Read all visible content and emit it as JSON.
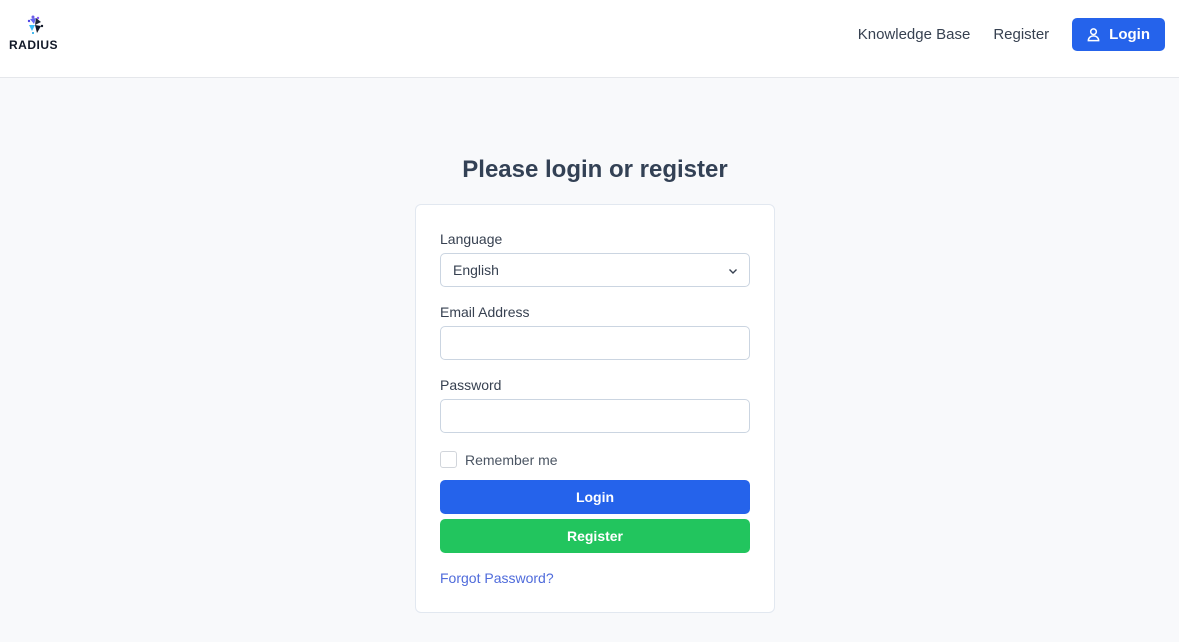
{
  "header": {
    "logo_text": "RADIUS",
    "nav": {
      "knowledge_base": "Knowledge Base",
      "register": "Register",
      "login": "Login"
    }
  },
  "main": {
    "title": "Please login or register",
    "form": {
      "language_label": "Language",
      "language_value": "English",
      "email_label": "Email Address",
      "email_value": "",
      "password_label": "Password",
      "password_value": "",
      "remember_label": "Remember me",
      "remember_checked": false,
      "login_button": "Login",
      "register_button": "Register",
      "forgot_link": "Forgot Password?"
    }
  },
  "colors": {
    "primary": "#2563eb",
    "success": "#22c55e",
    "link": "#4f6bdb"
  }
}
